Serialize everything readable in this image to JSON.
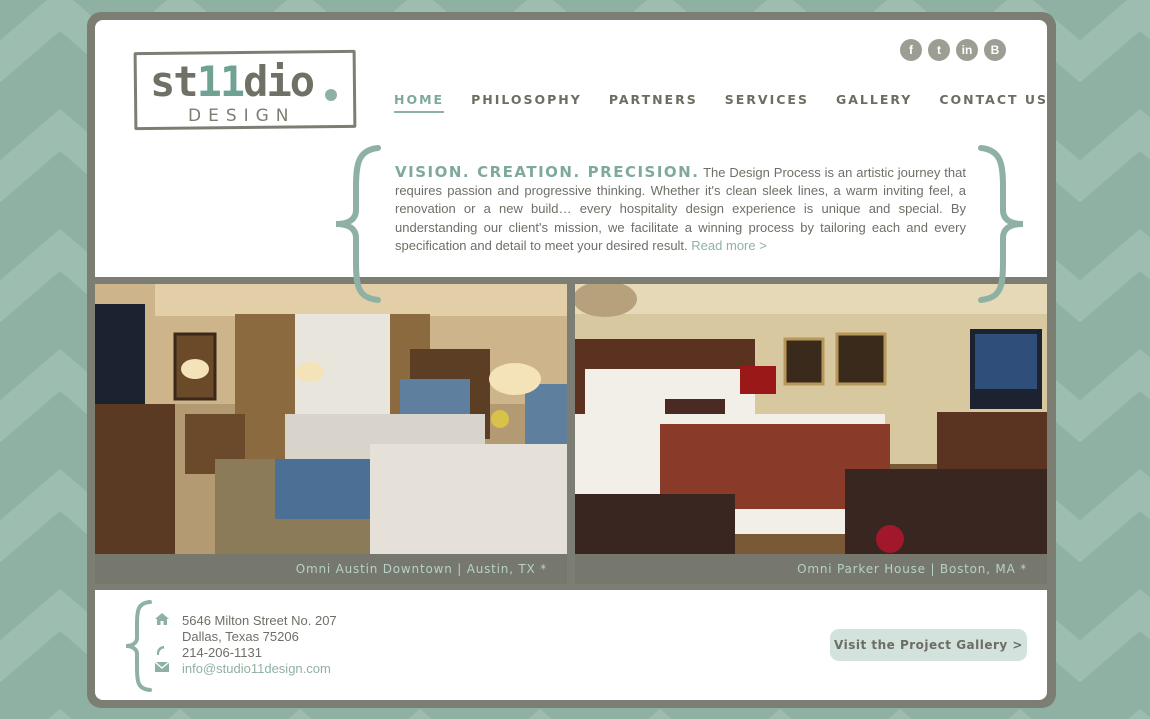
{
  "colors": {
    "background": "#8fb1a3",
    "chevron": "#9dbdb0",
    "frame": "#7d7e73",
    "accent": "#7fa99b",
    "text": "#6e6f66",
    "button": "#d3e2dc"
  },
  "logo": {
    "word_start": "st",
    "word_nums": "11",
    "word_end": "dio",
    "sub": "DESIGN"
  },
  "social": [
    {
      "icon": "facebook-icon",
      "glyph": "f"
    },
    {
      "icon": "twitter-icon",
      "glyph": "t"
    },
    {
      "icon": "linkedin-icon",
      "glyph": "in"
    },
    {
      "icon": "blogger-icon",
      "glyph": "B"
    }
  ],
  "nav": {
    "items": [
      {
        "label": "HOME",
        "active": true
      },
      {
        "label": "PHILOSOPHY"
      },
      {
        "label": "PARTNERS"
      },
      {
        "label": "SERVICES"
      },
      {
        "label": "GALLERY"
      },
      {
        "label": "CONTACT US"
      }
    ]
  },
  "intro": {
    "heading": "VISION. CREATION. PRECISION.",
    "body": "The Design Process is an artistic journey that requires passion and progressive thinking. Whether it's clean sleek lines, a warm inviting feel, a renovation or a new build… every hospitality design experience is unique and special. By understanding our client's mission, we facilitate a winning process by tailoring each and every specification and detail to meet your desired result.",
    "read_more": "Read more >"
  },
  "photos": [
    {
      "caption": "Omni Austin Downtown | Austin, TX *"
    },
    {
      "caption": "Omni Parker House | Boston, MA *"
    }
  ],
  "contact": {
    "address_line1": "5646 Milton Street No. 207",
    "address_line2": "Dallas, Texas 75206",
    "phone": "214-206-1131",
    "email": "info@studio11design.com"
  },
  "footer": {
    "gallery_button": "Visit the Project Gallery >"
  }
}
